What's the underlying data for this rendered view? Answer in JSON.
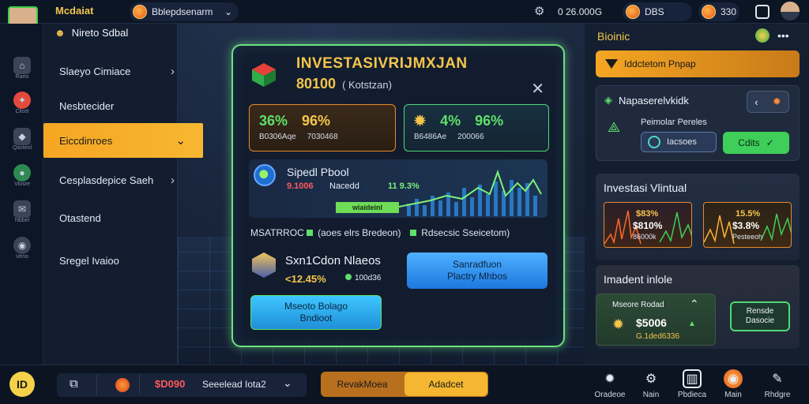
{
  "topbar": {
    "app_name": "Mcdaiat",
    "dropdown_label": "Bblepdsenarm",
    "balance_1": "0 26.000G",
    "balance_2": "DBS",
    "balance_3": "330"
  },
  "menu": {
    "header": "Nireto Sdbal",
    "items": [
      {
        "label": "Slaeyo Cimiace",
        "chevron": true
      },
      {
        "label": "Nesbtecider",
        "chevron": false
      },
      {
        "label": "Eiccdinroes",
        "chevron": true,
        "active": true
      },
      {
        "label": "Cesplasdepice Saeh",
        "chevron": true
      },
      {
        "label": "Otastend",
        "chevron": false
      },
      {
        "label": "Sregel Ivaioo",
        "chevron": false
      }
    ]
  },
  "modal": {
    "title": "INVESTASIVRIJMXJAN",
    "amount": "80100",
    "amount_sub": "( Kotstzan)",
    "stat_left": {
      "v1": "36%",
      "v2": "96%",
      "s1": "B0306Aqe",
      "s2": "7030468"
    },
    "stat_right": {
      "v1": "4%",
      "v2": "96%",
      "s1": "B6486Ae",
      "s2": "200066"
    },
    "pool": {
      "title": "Sipedl Pbool",
      "red_value": "9.1006",
      "mid_text": "Nacedd",
      "green_value": "11 9.3%",
      "bar_label": "wiaideinl"
    },
    "meta_line": "MSATRROC",
    "meta_a": "(aoes elrs Bredeon)",
    "meta_b": "Rdsecsic Sseicetom)",
    "badge": {
      "title": "Sxn1Cdon Nlaeos",
      "value": "<12.45%",
      "sub": "100d36"
    },
    "btn_primary": "Sanradfuon\nPlactry Mhbos",
    "btn_secondary": "Mseoto Bolago\nBndioot"
  },
  "right_panel": {
    "title": "Bioinic",
    "banner": "Iddctetom Pnpap",
    "box1": {
      "title": "Napaserelvkidk",
      "sub": "Peimolar Pereles",
      "input": "Iacsoes",
      "button": "Cdits"
    },
    "box2": {
      "title": "Investasi Vlintual",
      "c1": {
        "a": "$83%",
        "b": "$810%",
        "c": "86000k"
      },
      "c2": {
        "a": "15.5%",
        "b": "$3.8%",
        "c": "Pesteeoh"
      }
    },
    "box3": {
      "title": "Imadent inlole",
      "label": "Mseore Rodad",
      "value": "$5006",
      "sub": "G.1ded6336",
      "button": "Rensde\nDasocie"
    }
  },
  "rail": [
    "Raeo",
    "Clicel",
    "Qasteol",
    "Vlosre",
    "Nbbel",
    "Veno"
  ],
  "bottombar": {
    "logo": "ID",
    "amount": "$D090",
    "selector": "Seeelead Iota2",
    "seg_left": "RevakMoea",
    "seg_right": "Adadcet",
    "nav": [
      {
        "label": "Oradeoe",
        "icon": "gear-icon"
      },
      {
        "label": "Nain",
        "icon": "settings-icon"
      },
      {
        "label": "Pbdieca",
        "icon": "panel-icon"
      },
      {
        "label": "Main",
        "icon": "coin-icon"
      },
      {
        "label": "Rhdgre",
        "icon": "chat-icon"
      }
    ]
  },
  "colors": {
    "accent": "#f5a623",
    "green": "#5fe06b",
    "blue": "#1d78df",
    "danger": "#ff5a5a"
  }
}
